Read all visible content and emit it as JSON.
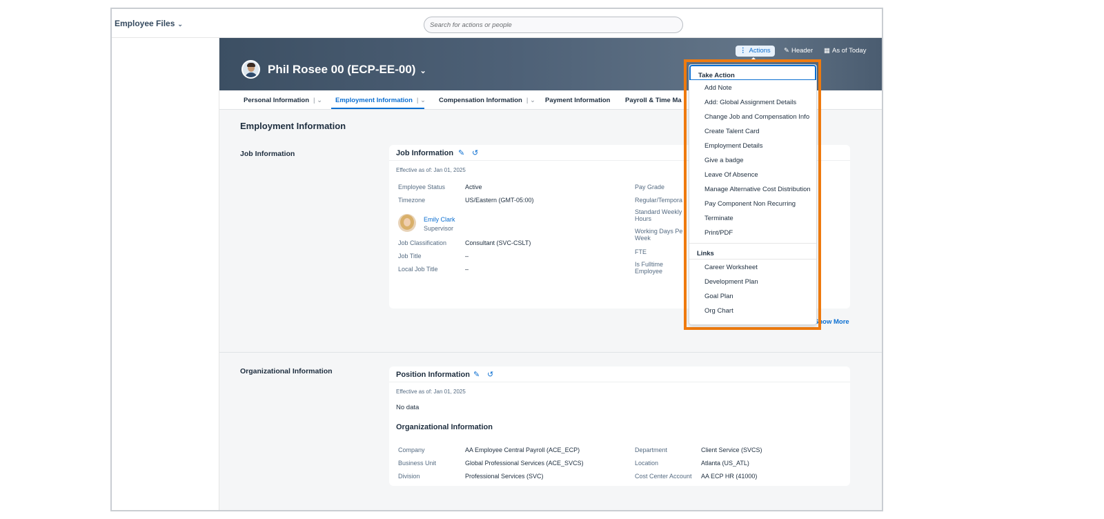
{
  "app": {
    "title": "Employee Files"
  },
  "search": {
    "placeholder": "Search for actions or people"
  },
  "employee": {
    "name": "Phil Rosee 00 (ECP-EE-00)"
  },
  "header_buttons": {
    "actions": "Actions",
    "header": "Header",
    "as_of": "As of Today"
  },
  "tabs": [
    {
      "label": "Personal Information"
    },
    {
      "label": "Employment Information"
    },
    {
      "label": "Compensation Information"
    },
    {
      "label": "Payment Information"
    },
    {
      "label": "Payroll & Time Ma"
    }
  ],
  "main": {
    "title": "Employment Information",
    "job_section_label": "Job Information",
    "org_section_label": "Organizational Information"
  },
  "job_card": {
    "title": "Job Information",
    "effective": "Effective as of: Jan 01, 2025",
    "fields_left": [
      {
        "label": "Employee Status",
        "value": "Active"
      },
      {
        "label": "Timezone",
        "value": "US/Eastern (GMT-05:00)"
      },
      {
        "label": "Job Classification",
        "value": "Consultant (SVC-CSLT)"
      },
      {
        "label": "Job Title",
        "value": "–"
      },
      {
        "label": "Local Job Title",
        "value": "–"
      }
    ],
    "supervisor": {
      "name": "Emily Clark",
      "role": "Supervisor"
    },
    "fields_right": [
      {
        "label": "Pay Grade"
      },
      {
        "label": "Regular/Tempora"
      },
      {
        "label": "Standard Weekly Hours"
      },
      {
        "label": "Working Days Pe Week"
      },
      {
        "label": "FTE"
      },
      {
        "label": "Is Fulltime Employee"
      }
    ],
    "show_more": "Show More"
  },
  "position_card": {
    "title": "Position Information",
    "effective": "Effective as of: Jan 01, 2025",
    "no_data": "No data",
    "org_heading": "Organizational Information",
    "fields_left": [
      {
        "label": "Company",
        "value": "AA Employee Central Payroll (ACE_ECP)"
      },
      {
        "label": "Business Unit",
        "value": "Global Professional Services (ACE_SVCS)"
      },
      {
        "label": "Division",
        "value": "Professional Services (SVC)"
      }
    ],
    "fields_right": [
      {
        "label": "Department",
        "value": "Client Service (SVCS)"
      },
      {
        "label": "Location",
        "value": "Atlanta (US_ATL)"
      },
      {
        "label": "Cost Center Account",
        "value": "AA ECP HR (41000)"
      }
    ]
  },
  "actions_menu": {
    "take_action_heading": "Take Action",
    "take_action_items": [
      "Add Note",
      "Add: Global Assignment Details",
      "Change Job and Compensation Info",
      "Create Talent Card",
      "Employment Details",
      "Give a badge",
      "Leave Of Absence",
      "Manage Alternative Cost Distribution",
      "Pay Component Non Recurring",
      "Terminate",
      "Print/PDF"
    ],
    "links_heading": "Links",
    "link_items": [
      "Career Worksheet",
      "Development Plan",
      "Goal Plan",
      "Org Chart"
    ]
  },
  "colors": {
    "accent": "#0a6ed1",
    "highlight": "#f07b0f",
    "banner": "#4e6177"
  }
}
